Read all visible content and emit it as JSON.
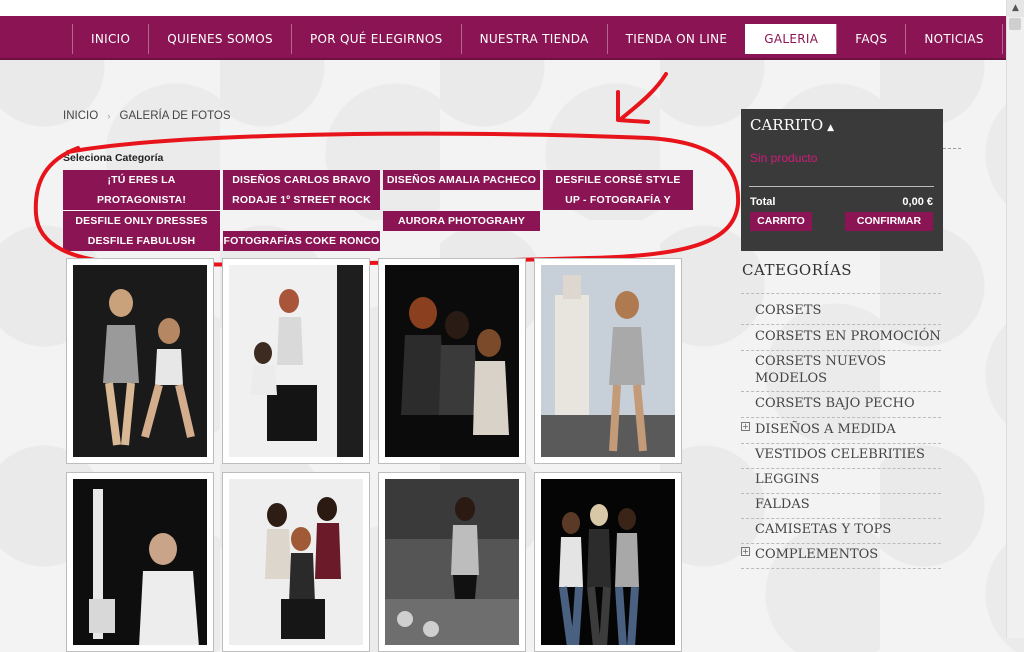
{
  "nav": {
    "items": [
      "INICIO",
      "QUIENES SOMOS",
      "POR QUÉ ELEGIRNOS",
      "NUESTRA TIENDA",
      "TIENDA ON LINE",
      "GALERIA",
      "FAQS",
      "NOTICIAS"
    ],
    "active": "GALERIA"
  },
  "breadcrumb": {
    "home": "INICIO",
    "separator": "›",
    "current": "GALERÍA DE FOTOS"
  },
  "categories_select": {
    "title": "Seleciona Categoría",
    "items": [
      "¡TÚ ERES LA PROTAGONISTA!",
      "DISEÑOS CARLOS BRAVO",
      "DISEÑOS AMALIA PACHECO",
      "DESFILE CORSÉ STYLE",
      "RODAJE 1º STREET ROCK",
      "UP - FOTOGRAFÍA Y",
      "DESFILE ONLY DRESSES",
      "AURORA PHOTOGRAHY",
      "DESFILE FABULUSH",
      "FOTOGRAFÍAS COKE RONCO"
    ]
  },
  "gallery": {
    "photo_count": 8
  },
  "cart": {
    "title": "CARRITO",
    "empty_text": "Sin producto",
    "total_label": "Total",
    "total_value": "0,00 €",
    "cart_button": "CARRITO",
    "confirm_button": "CONFIRMAR"
  },
  "sidebar": {
    "heading": "CATEGORÍAS",
    "items": [
      {
        "label": "CORSETS",
        "expandable": false
      },
      {
        "label": "CORSETS EN PROMOCIÓN",
        "expandable": false
      },
      {
        "label": "CORSETS NUEVOS MODELOS",
        "expandable": false
      },
      {
        "label": "CORSETS BAJO PECHO",
        "expandable": false
      },
      {
        "label": "DISEÑOS A MEDIDA",
        "expandable": true
      },
      {
        "label": "VESTIDOS CELEBRITIES",
        "expandable": false
      },
      {
        "label": "LEGGINS",
        "expandable": false
      },
      {
        "label": "FALDAS",
        "expandable": false
      },
      {
        "label": "CAMISETAS Y TOPS",
        "expandable": false
      },
      {
        "label": "COMPLEMENTOS",
        "expandable": true
      }
    ]
  },
  "colors": {
    "brand": "#8b1554",
    "cart_bg": "#3a3a3a",
    "accent_pink": "#d21a7b",
    "annotation_red": "#e8141b"
  }
}
